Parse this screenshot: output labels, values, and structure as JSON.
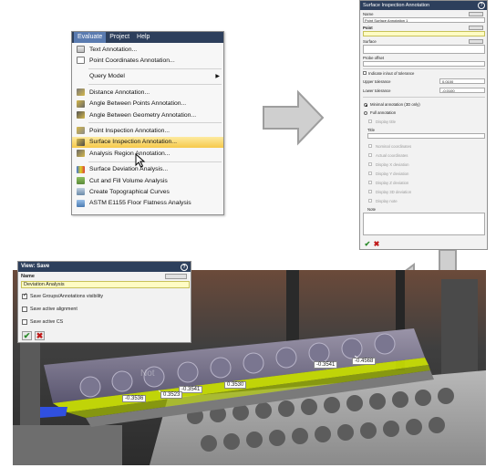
{
  "menu": {
    "bar": [
      "Evaluate",
      "Project",
      "Help"
    ],
    "items": [
      {
        "label": "Text Annotation...",
        "icon": "text-annotation-icon"
      },
      {
        "label": "Point Coordinates Annotation...",
        "icon": "point-coordinates-icon"
      },
      {
        "label": "Query Model",
        "icon": "none",
        "submenu": true
      },
      {
        "label": "Distance Annotation...",
        "icon": "distance-icon"
      },
      {
        "label": "Angle Between Points Annotation...",
        "icon": "angle-points-icon"
      },
      {
        "label": "Angle Between Geometry Annotation...",
        "icon": "angle-geometry-icon"
      },
      {
        "label": "Point Inspection Annotation...",
        "icon": "point-inspection-icon"
      },
      {
        "label": "Surface Inspection Annotation...",
        "icon": "surface-inspection-icon"
      },
      {
        "label": "Analysis Region Annotation...",
        "icon": "analysis-region-icon"
      },
      {
        "label": "Surface Deviation Analysis...",
        "icon": "surface-deviation-icon"
      },
      {
        "label": "Cut and Fill Volume Analysis",
        "icon": "cut-fill-icon"
      },
      {
        "label": "Create Topographical Curves",
        "icon": "topo-curves-icon"
      },
      {
        "label": "ASTM E1155 Floor Flatness Analysis",
        "icon": "floor-flatness-icon"
      }
    ],
    "highlighted": "Surface Inspection Annotation..."
  },
  "inspection_panel": {
    "title": "Surface Inspection Annotation",
    "name_label": "Name",
    "name_value": "Point Surface Annotation 1",
    "point_label": "Point",
    "surface_label": "Surface",
    "probe_label": "Probe offset",
    "indicate_label": "Indicate in/out of tolerance",
    "upper_label": "Upper tolerance",
    "upper_value": "0.0100",
    "lower_label": "Lower tolerance",
    "lower_value": "-0.0100",
    "minimal_label": "Minimal annotation (3D only)",
    "full_label": "Full annotation",
    "display_title": "Display title",
    "title_label": "Title",
    "options": [
      "Nominal coordinates",
      "Actual coordinates",
      "Display X deviation",
      "Display Y deviation",
      "Display Z deviation",
      "Display 3D deviation",
      "Display note"
    ],
    "note_label": "Note"
  },
  "save_dialog": {
    "title": "View: Save",
    "name_label": "Name",
    "name_value": "Deviation Analysis",
    "opt1": "Save Groups/Annotations visibility",
    "opt2": "Save active alignment",
    "opt3": "Save active CS"
  },
  "scene": {
    "annotations": [
      "-0.3541",
      "-0.4568",
      "-0.3536",
      "-0.3541",
      "0.3530",
      "0.3523"
    ],
    "watermark": "Not"
  },
  "colors": {
    "title_bar": "#2d3f5c",
    "highlight": "#f6c94a",
    "deviation": "#d8f000",
    "ok": "#2a8a2a",
    "cancel": "#c01818"
  }
}
